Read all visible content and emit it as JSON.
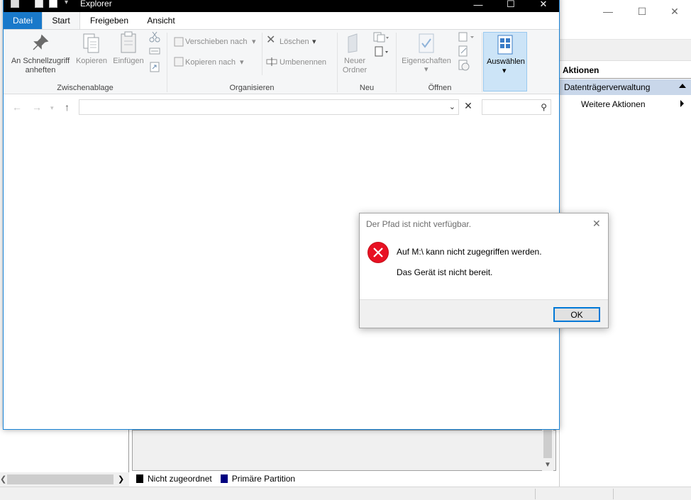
{
  "background_window": {
    "actions_title": "Aktionen",
    "actions_selected": "Datenträgerverwaltung",
    "actions_more": "Weitere Aktionen",
    "legend": [
      {
        "label": "Nicht zugeordnet",
        "color": "#000000"
      },
      {
        "label": "Primäre Partition",
        "color": "#000080"
      }
    ]
  },
  "explorer": {
    "title": "Explorer",
    "tabs": [
      "Datei",
      "Start",
      "Freigeben",
      "Ansicht"
    ],
    "ribbon": {
      "clipboard": {
        "pin_label": "An Schnellzugriff anheften",
        "copy_label": "Kopieren",
        "paste_label": "Einfügen",
        "group_label": "Zwischenablage"
      },
      "organize": {
        "move_label": "Verschieben nach",
        "copyto_label": "Kopieren nach",
        "delete_label": "Löschen",
        "rename_label": "Umbenennen",
        "group_label": "Organisieren"
      },
      "new": {
        "newfolder_label": "Neuer Ordner",
        "group_label": "Neu"
      },
      "open": {
        "properties_label": "Eigenschaften",
        "group_label": "Öffnen"
      },
      "select": {
        "select_label": "Auswählen"
      }
    },
    "address_value": "",
    "search_value": ""
  },
  "dialog": {
    "title": "Der Pfad ist nicht verfügbar.",
    "message": "Auf M:\\ kann nicht zugegriffen werden.",
    "detail": "Das Gerät ist nicht bereit.",
    "ok_label": "OK"
  }
}
